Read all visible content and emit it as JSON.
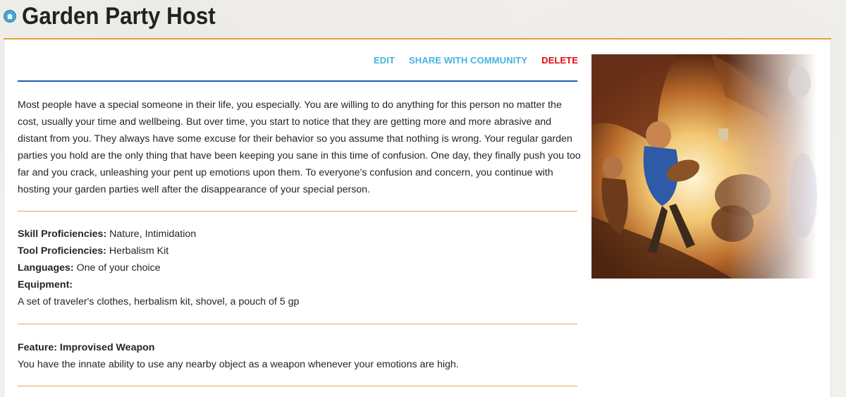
{
  "header": {
    "title": "Garden Party Host",
    "home_icon": "home-icon"
  },
  "actions": {
    "edit": "EDIT",
    "share": "SHARE WITH COMMUNITY",
    "delete": "DELETE"
  },
  "description": "Most people have a special someone in their life, you especially. You are willing to do anything for this person no matter the cost, usually your time and wellbeing. But over time, you start to notice that they are getting more and more abrasive and distant from you. They always have some excuse for their behavior so you assume that nothing is wrong. Your regular garden parties you hold are the only thing that have been keeping you sane in this time of confusion. One day, they finally push you too far and you crack, unleashing your pent up emotions upon them. To everyone's confusion and concern, you continue with hosting your garden parties well after the disappearance of your special person.",
  "proficiencies": {
    "skill_label": "Skill Proficiencies:",
    "skill_value": " Nature, Intimidation",
    "tool_label": "Tool Proficiencies:",
    "tool_value": " Herbalism Kit",
    "languages_label": "Languages:",
    "languages_value": " One of your choice",
    "equipment_label": "Equipment:",
    "equipment_value": "A set of traveler's clothes, herbalism kit, shovel, a pouch of 5 gp"
  },
  "feature": {
    "title": "Feature: Improvised Weapon",
    "text": "You have the innate ability to use any nearby object as a weapon whenever your emotions are high."
  },
  "colors": {
    "accent_orange": "#e0a13a",
    "link_blue": "#47b3e0",
    "delete_red": "#e40712",
    "rule_blue": "#1b5bb8"
  }
}
